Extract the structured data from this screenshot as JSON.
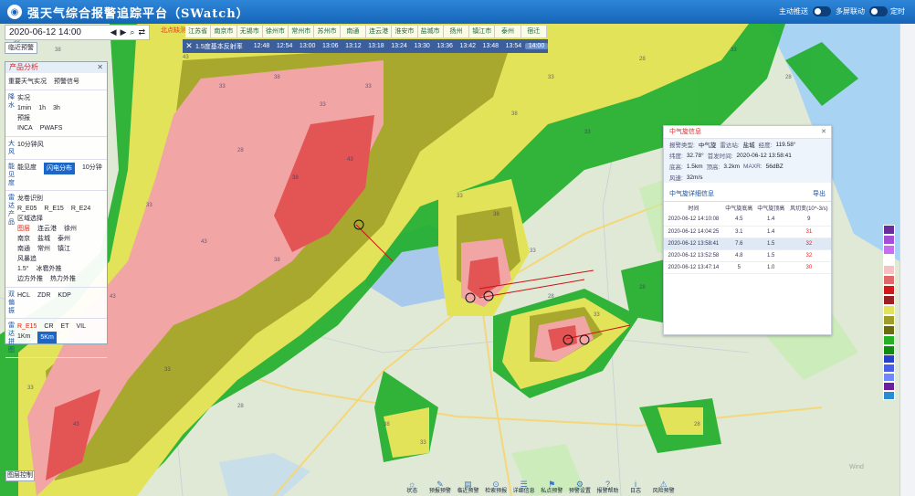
{
  "header": {
    "title": "强天气综合报警追踪平台（SWatch）",
    "toggle1": "主动推送",
    "toggle2": "多屏联动",
    "toggle3": "定时"
  },
  "timebar": {
    "datetime": "2020-06-12 14:00"
  },
  "warning_btn": "临近预警",
  "nodata_label": "北点缺测",
  "city_tabs": [
    "江苏省",
    "南京市",
    "无锡市",
    "徐州市",
    "常州市",
    "苏州市",
    "南通",
    "连云港",
    "淮安市",
    "盐城市",
    "扬州",
    "镇江市",
    "泰州",
    "宿迁"
  ],
  "ticks": {
    "label": "1.5度基本反射率",
    "times": [
      "12:48",
      "12:54",
      "13:00",
      "13:06",
      "13:12",
      "13:18",
      "13:24",
      "13:30",
      "13:36",
      "13:42",
      "13:48",
      "13:54",
      "14:00"
    ]
  },
  "panel": {
    "title": "产品分析",
    "tabs": [
      "重要天气实况",
      "预警信号"
    ],
    "groups": [
      {
        "label": "降水",
        "rows": [
          [
            "实况"
          ],
          [
            "1min",
            "1h",
            "3h"
          ],
          [
            "预报"
          ],
          [
            "INCA",
            "PWAFS"
          ]
        ]
      },
      {
        "label": "大风",
        "rows": [
          [
            "10分钟风"
          ]
        ]
      },
      {
        "label": "能见度",
        "rows": [
          [
            "能见度",
            "闪电分布",
            "10分钟"
          ]
        ]
      },
      {
        "label": "雷达产品",
        "rows": [
          [
            "龙卷识别"
          ],
          [
            "R_E05",
            "R_E15",
            "R_E24"
          ],
          [
            "区域选择"
          ],
          [
            "图层",
            "连云港",
            "徐州"
          ],
          [
            "南京",
            "盐城",
            "泰州"
          ],
          [
            "南通",
            "常州",
            "镇江"
          ],
          [
            "风暴追"
          ],
          [
            "1.5°",
            "冰雹外推"
          ],
          [
            "边方外推",
            "热力外推"
          ]
        ]
      },
      {
        "label": "双偏振",
        "rows": [
          [
            "HCL",
            "ZDR",
            "KDP"
          ]
        ]
      },
      {
        "label": "雷达拼图",
        "rows": [
          [
            "R_E15",
            "CR",
            "ET",
            "VIL"
          ],
          [
            "1Km",
            "5Km"
          ]
        ]
      }
    ]
  },
  "popup": {
    "title": "中气旋信息",
    "fields": [
      [
        [
          "报警类型:",
          "中气旋"
        ],
        [
          "雷达站:",
          "盐城"
        ],
        [
          "经度:",
          "119.58°"
        ]
      ],
      [
        [
          "纬度:",
          "32.78°"
        ],
        [
          "首发时间:",
          "2020-06-12 13:58:41"
        ]
      ],
      [
        [
          "底高:",
          "1.5km"
        ],
        [
          "顶高:",
          "3.2km"
        ],
        [
          "MAXR:",
          "56dBZ"
        ]
      ],
      [
        [
          "风速:",
          "32m/s"
        ]
      ]
    ],
    "sub_title": "中气旋详细信息",
    "export": "导出",
    "columns": [
      "时间",
      "中气旋底高",
      "中气旋顶高",
      "风切变(10^-3/s)"
    ],
    "rows": [
      [
        "2020-06-12 14:10:08",
        "4.5",
        "1.4",
        "9"
      ],
      [
        "2020-06-12 14:04:25",
        "3.1",
        "1.4",
        "31"
      ],
      [
        "2020-06-12 13:58:41",
        "7.6",
        "1.5",
        "32"
      ],
      [
        "2020-06-12 13:52:58",
        "4.8",
        "1.5",
        "32"
      ],
      [
        "2020-06-12 13:47:14",
        "5",
        "1.0",
        "30"
      ]
    ]
  },
  "bottom_bar": [
    "状态",
    "预报预警",
    "临近预警",
    "检索预报",
    "详细信息",
    "私点预警",
    "预警设置",
    "报警帮助",
    "日志",
    "风险预警"
  ],
  "bottom_btn": "图层控制",
  "watermark": "Wind",
  "legend_colors": [
    "#6a2d9e",
    "#a44fd6",
    "#c86df0",
    "#ffffff",
    "#f8c0c0",
    "#e06868",
    "#d11919",
    "#9b2222",
    "#e3e35a",
    "#9e9e28",
    "#6b6b10",
    "#24b224",
    "#0f8c0f",
    "#0b6c0b"
  ],
  "legend2_colors": [
    "#2940c8",
    "#4860e8",
    "#7088ff",
    "#6a1f9e",
    "#2a8ccf"
  ],
  "colors": {
    "accent": "#1565b8",
    "alert": "#e02020"
  }
}
